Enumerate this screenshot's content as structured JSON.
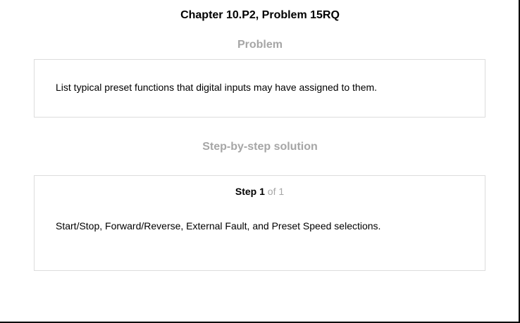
{
  "header": {
    "title": "Chapter 10.P2, Problem 15RQ"
  },
  "problem": {
    "heading": "Problem",
    "text": "List typical preset functions that digital inputs may have assigned to them."
  },
  "solution": {
    "heading": "Step-by-step solution",
    "step": {
      "word": "Step",
      "number": "1",
      "of_text": "of 1"
    },
    "text": "Start/Stop, Forward/Reverse, External Fault, and Preset Speed selections."
  },
  "colors": {
    "heading_gray": "#a6a6a6",
    "box_border": "#dcdcdc"
  }
}
